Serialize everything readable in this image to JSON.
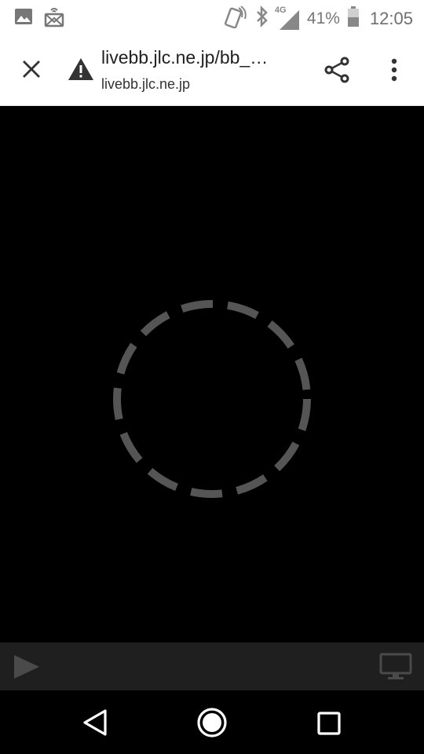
{
  "status_bar": {
    "left_icons": [
      "image-icon",
      "cast-icon"
    ],
    "right_icons": [
      "nfc-icon",
      "bluetooth-icon",
      "signal-4g-icon",
      "battery-icon"
    ],
    "network": "4G",
    "battery_percent": "41%",
    "time": "12:05"
  },
  "toolbar": {
    "close_icon": "close-icon",
    "security_icon": "warning-icon",
    "url_title": "livebb.jlc.ne.jp/bb_…",
    "url_domain": "livebb.jlc.ne.jp",
    "share_icon": "share-icon",
    "menu_icon": "more-vert-icon"
  },
  "video": {
    "state": "loading",
    "spinner_icon": "dashed-loading-spinner-icon",
    "spinner_color": "#555555"
  },
  "controls": {
    "play_icon": "play-icon",
    "screen_icon": "monitor-icon",
    "icon_color": "#4a4a4a",
    "background": "#1f1f1f"
  },
  "nav_bar": {
    "icons": [
      "back-icon",
      "home-icon",
      "recents-icon"
    ]
  },
  "colors": {
    "toolbar_bg": "#ffffff",
    "video_bg": "#000000",
    "text_primary": "#212121"
  }
}
